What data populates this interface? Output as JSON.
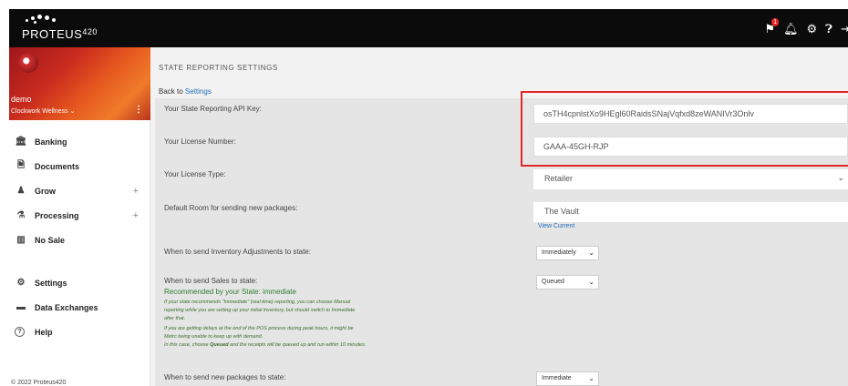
{
  "brand": {
    "name": "PROTEUS",
    "sup": "420"
  },
  "topbar": {
    "notification_count": "1"
  },
  "profile": {
    "username": "demo",
    "company": "Clockwork Wellness ⌄",
    "menu_glyph": "⋮"
  },
  "nav": {
    "items": [
      {
        "label": "Banking",
        "icon": "bank-icon",
        "glyph": "🏛"
      },
      {
        "label": "Documents",
        "icon": "document-icon",
        "glyph": "🗎"
      },
      {
        "label": "Grow",
        "icon": "grow-icon",
        "glyph": "♟",
        "expand": "+"
      },
      {
        "label": "Processing",
        "icon": "flask-icon",
        "glyph": "⚗",
        "expand": "+"
      },
      {
        "label": "No Sale",
        "icon": "no-sale-icon",
        "glyph": "▥"
      }
    ],
    "secondary": [
      {
        "label": "Settings",
        "icon": "gear-icon",
        "glyph": "⚙"
      },
      {
        "label": "Data Exchanges",
        "icon": "exchange-icon",
        "glyph": "▬"
      },
      {
        "label": "Help",
        "icon": "help-icon",
        "glyph": "?"
      }
    ]
  },
  "footer": {
    "copyright": "© 2022 Proteus420"
  },
  "page": {
    "title": "STATE REPORTING SETTINGS",
    "back_prefix": "Back to",
    "back_link": "Settings"
  },
  "form": {
    "api_key_label": "Your State Reporting API Key:",
    "api_key_value": "osTH4cpnlstXo9HEgl60RaidsSNajVqfxd8zeWANIVr3Onlv",
    "license_number_label": "Your License Number:",
    "license_number_value": "GAAA-45GH-RJP",
    "license_type_label": "Your License Type:",
    "license_type_value": "Retailer",
    "default_room_label": "Default Room for sending new packages:",
    "default_room_value": "The Vault",
    "view_current": "View Current",
    "inventory_adj_label": "When to send Inventory Adjustments to state:",
    "inventory_adj_value": "Immediately",
    "sales_label": "When to send Sales to state:",
    "sales_value": "Queued",
    "sales_recommended": "Recommended by your State: immediate",
    "sales_note_1": "If your state recommends \"Immediate\" (real-time) reporting, you can choose Manual",
    "sales_note_2": "reporting while you are setting up your initial inventory, but should switch to Immediate",
    "sales_note_3": "after that.",
    "sales_note_4": "If you are getting delays at the end of the POS process during peak hours, it might be",
    "sales_note_5": "Metrc being unable to keep up with demand.",
    "sales_note_6_pre": "In this case, choose",
    "sales_note_6_bold": "Queued",
    "sales_note_6_post": "and the receipts will be queued up and run within 10 minutes.",
    "new_packages_label": "When to send new packages to state:",
    "new_packages_value": "Immediate"
  },
  "colors": {
    "topbar": "#0b0b0b",
    "highlight_box": "#e0272b",
    "link": "#1f6fb8",
    "recommended": "#2e7d32"
  }
}
